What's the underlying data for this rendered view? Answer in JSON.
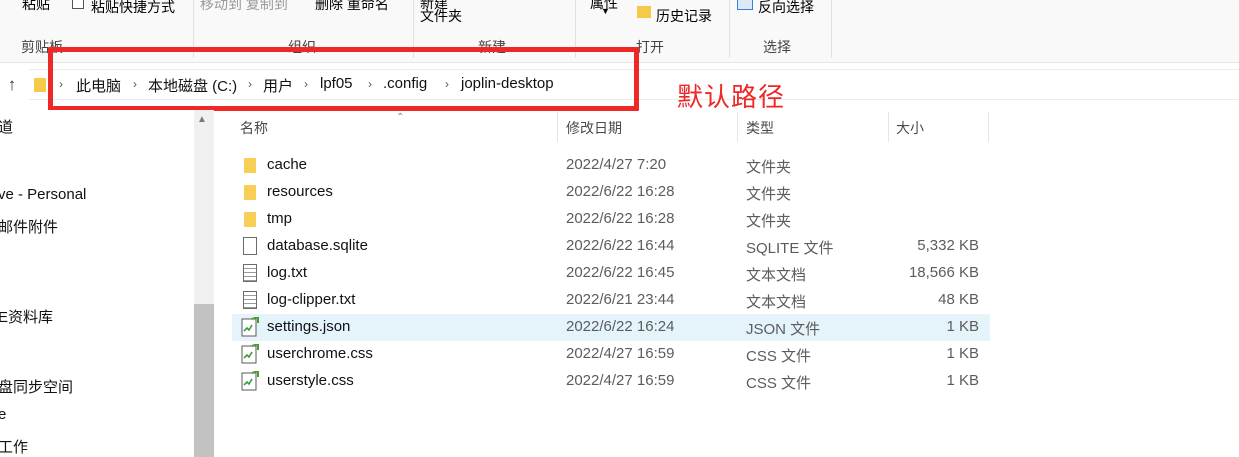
{
  "ribbon": {
    "top_fragments": [
      "粘贴",
      "粘贴快捷方式",
      "移动到  复制到",
      "删除  重命名",
      "新建",
      "属性"
    ],
    "new_folder_label": "文件夹",
    "history_label": "历史记录",
    "invert_selection_label": "反向选择",
    "groups": {
      "clipboard": "剪贴板",
      "organize": "组织",
      "new": "新建",
      "open": "打开",
      "select": "选择"
    }
  },
  "address": {
    "breadcrumbs": [
      "此电脑",
      "本地磁盘 (C:)",
      "用户",
      "lpf05",
      ".config",
      "joplin-desktop"
    ],
    "annotation": "默认路径"
  },
  "nav": {
    "items": [
      "道",
      "ve - Personal",
      "邮件附件",
      "E资料库",
      "盘同步空间",
      "e",
      "工作"
    ]
  },
  "columns": {
    "name": "名称",
    "date": "修改日期",
    "type": "类型",
    "size": "大小"
  },
  "files": [
    {
      "name": "cache",
      "date": "2022/4/27 7:20",
      "type": "文件夹",
      "size": "",
      "icon": "folder-icon"
    },
    {
      "name": "resources",
      "date": "2022/6/22 16:28",
      "type": "文件夹",
      "size": "",
      "icon": "folder-icon"
    },
    {
      "name": "tmp",
      "date": "2022/6/22 16:28",
      "type": "文件夹",
      "size": "",
      "icon": "folder-icon"
    },
    {
      "name": "database.sqlite",
      "date": "2022/6/22 16:44",
      "type": "SQLITE 文件",
      "size": "5,332 KB",
      "icon": "file-icon"
    },
    {
      "name": "log.txt",
      "date": "2022/6/22 16:45",
      "type": "文本文档",
      "size": "18,566 KB",
      "icon": "text-file-icon"
    },
    {
      "name": "log-clipper.txt",
      "date": "2022/6/21 23:44",
      "type": "文本文档",
      "size": "48 KB",
      "icon": "text-file-icon"
    },
    {
      "name": "settings.json",
      "date": "2022/6/22 16:24",
      "type": "JSON 文件",
      "size": "1 KB",
      "icon": "json-file-icon",
      "selected": true
    },
    {
      "name": "userchrome.css",
      "date": "2022/4/27 16:59",
      "type": "CSS 文件",
      "size": "1 KB",
      "icon": "css-file-icon"
    },
    {
      "name": "userstyle.css",
      "date": "2022/4/27 16:59",
      "type": "CSS 文件",
      "size": "1 KB",
      "icon": "css-file-icon"
    }
  ],
  "colors": {
    "annotation_red": "#ee2727",
    "selection": "#e5f3fb",
    "folder": "#f8cf56"
  }
}
